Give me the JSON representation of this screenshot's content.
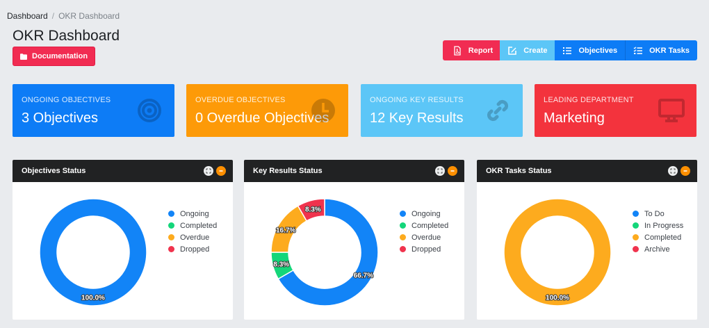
{
  "breadcrumb": {
    "home": "Dashboard",
    "separator": "/",
    "current": "OKR Dashboard"
  },
  "page": {
    "title": "OKR Dashboard",
    "documentation_label": "Documentation"
  },
  "toolbar": {
    "report": "Report",
    "create": "Create",
    "objectives": "Objectives",
    "okr_tasks": "OKR Tasks"
  },
  "stats": [
    {
      "label": "ONGOING OBJECTIVES",
      "value": "3 Objectives",
      "icon": "target-icon",
      "color": "#0d7cf6"
    },
    {
      "label": "OVERDUE OBJECTIVES",
      "value": "0 Overdue Objectives",
      "icon": "clock-icon",
      "color": "#fd9a08"
    },
    {
      "label": "ONGOING KEY RESULTS",
      "value": "12 Key Results",
      "icon": "link-icon",
      "color": "#5cc6f7"
    },
    {
      "label": "LEADING DEPARTMENT",
      "value": "Marketing",
      "icon": "monitor-icon",
      "color": "#f3333d"
    }
  ],
  "panels": [
    {
      "title": "Objectives Status",
      "legend": [
        {
          "label": "Ongoing",
          "color": "#1284f7"
        },
        {
          "label": "Completed",
          "color": "#14d67a"
        },
        {
          "label": "Overdue",
          "color": "#fdab1e"
        },
        {
          "label": "Dropped",
          "color": "#f0334d"
        }
      ],
      "slices": [
        {
          "value": 100.0,
          "color": "#1284f7",
          "label": "100.0%"
        }
      ]
    },
    {
      "title": "Key Results Status",
      "legend": [
        {
          "label": "Ongoing",
          "color": "#1284f7"
        },
        {
          "label": "Completed",
          "color": "#14d67a"
        },
        {
          "label": "Overdue",
          "color": "#fdab1e"
        },
        {
          "label": "Dropped",
          "color": "#f0334d"
        }
      ],
      "slices": [
        {
          "value": 66.7,
          "color": "#1284f7",
          "label": "66.7%"
        },
        {
          "value": 8.3,
          "color": "#14d67a",
          "label": "8.3%"
        },
        {
          "value": 16.7,
          "color": "#fdab1e",
          "label": "16.7%"
        },
        {
          "value": 8.3,
          "color": "#f0334d",
          "label": "8.3%"
        }
      ]
    },
    {
      "title": "OKR Tasks Status",
      "legend": [
        {
          "label": "To Do",
          "color": "#1284f7"
        },
        {
          "label": "In Progress",
          "color": "#14d67a"
        },
        {
          "label": "Completed",
          "color": "#fdab1e"
        },
        {
          "label": "Archive",
          "color": "#f0334d"
        }
      ],
      "slices": [
        {
          "value": 100.0,
          "color": "#fdab1e",
          "label": "100.0%"
        }
      ]
    }
  ]
}
